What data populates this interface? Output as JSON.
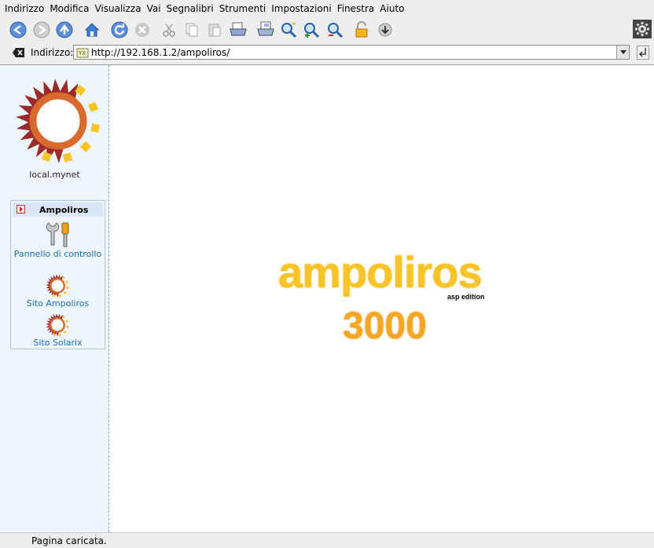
{
  "menu": [
    "Indirizzo",
    "Modifica",
    "Visualizza",
    "Vai",
    "Segnalibri",
    "Strumenti",
    "Impostazioni",
    "Finestra",
    "Aiuto"
  ],
  "toolbar_icons": [
    "back-icon",
    "forward-icon",
    "up-icon",
    "home-icon",
    "reload-icon",
    "stop-icon",
    "cut-icon",
    "copy-icon",
    "paste-icon",
    "print-icon",
    "print-frame-icon",
    "find-icon",
    "zoom-in-icon",
    "zoom-out-icon",
    "lock-icon",
    "download-icon",
    "gear-icon"
  ],
  "address": {
    "label": "Indirizzo:",
    "url": "http://192.168.1.2/ampoliros/"
  },
  "sidebar": {
    "host": "local.mynet",
    "box_title": "Ampoliros",
    "links": [
      "Pannello di controllo",
      "Sito Ampoliros",
      "Sito Solarix"
    ]
  },
  "main_logo": {
    "word": "ampoliros",
    "edition": "asp edition",
    "number": "3000"
  },
  "status": "Pagina caricata.",
  "colors": {
    "sun_red": "#9b2a2a",
    "sun_orange": "#d86a2e",
    "sun_yellow": "#f7c428",
    "link": "#1a6fb8"
  }
}
